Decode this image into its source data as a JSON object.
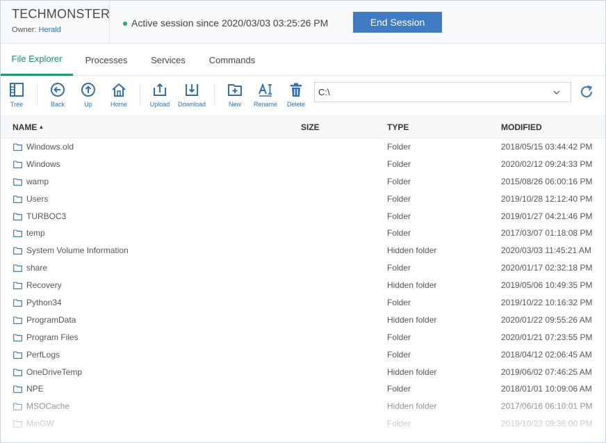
{
  "device": {
    "name": "TECHMONSTER",
    "owner_prefix": "Owner: ",
    "owner_name": "Herald"
  },
  "session": {
    "status_text": "Active session since 2020/03/03 03:25:26 PM",
    "end_label": "End Session"
  },
  "tabs": [
    {
      "label": "File Explorer",
      "active": true
    },
    {
      "label": "Processes"
    },
    {
      "label": "Services"
    },
    {
      "label": "Commands"
    }
  ],
  "toolbar": {
    "tree": "Tree",
    "back": "Back",
    "up": "Up",
    "home": "Home",
    "upload": "Upload",
    "download": "Download",
    "new": "New",
    "rename": "Rename",
    "delete": "Delete"
  },
  "path": {
    "value": "C:\\"
  },
  "colors": {
    "accent": "#3f7cc4",
    "active_tab": "#1f9a72",
    "status_dot": "#2aa876",
    "icon_blue": "#2f6fb5"
  },
  "columns": {
    "name": "NAME",
    "size": "SIZE",
    "type": "TYPE",
    "modified": "MODIFIED"
  },
  "sort": {
    "column": "name",
    "direction": "ascending"
  },
  "rows": [
    {
      "name": "Windows.old",
      "type": "Folder",
      "modified": "2018/05/15 03:44:42 PM"
    },
    {
      "name": "Windows",
      "type": "Folder",
      "modified": "2020/02/12 09:24:33 PM"
    },
    {
      "name": "wamp",
      "type": "Folder",
      "modified": "2015/08/26 06:00:16 PM"
    },
    {
      "name": "Users",
      "type": "Folder",
      "modified": "2019/10/28 12:12:40 PM"
    },
    {
      "name": "TURBOC3",
      "type": "Folder",
      "modified": "2019/01/27 04:21:46 PM"
    },
    {
      "name": "temp",
      "type": "Folder",
      "modified": "2017/03/07 01:18:08 PM"
    },
    {
      "name": "System Volume Information",
      "type": "Hidden folder",
      "modified": "2020/03/03 11:45:21 AM"
    },
    {
      "name": "share",
      "type": "Folder",
      "modified": "2020/01/17 02:32:18 PM"
    },
    {
      "name": "Recovery",
      "type": "Hidden folder",
      "modified": "2019/05/06 10:49:35 PM"
    },
    {
      "name": "Python34",
      "type": "Folder",
      "modified": "2019/10/22 10:16:32 PM"
    },
    {
      "name": "ProgramData",
      "type": "Hidden folder",
      "modified": "2020/01/22 09:55:26 AM"
    },
    {
      "name": "Program Files",
      "type": "Folder",
      "modified": "2020/01/21 07:23:55 PM"
    },
    {
      "name": "PerfLogs",
      "type": "Folder",
      "modified": "2018/04/12 02:06:45 AM"
    },
    {
      "name": "OneDriveTemp",
      "type": "Hidden folder",
      "modified": "2019/06/02 07:46:25 AM"
    },
    {
      "name": "NPE",
      "type": "Folder",
      "modified": "2018/01/01 10:09:06 AM"
    },
    {
      "name": "MSOCache",
      "type": "Hidden folder",
      "modified": "2017/06/16 06:10:01 PM"
    },
    {
      "name": "MinGW",
      "type": "Folder",
      "modified": "2019/10/23 09:36:00 PM"
    }
  ]
}
